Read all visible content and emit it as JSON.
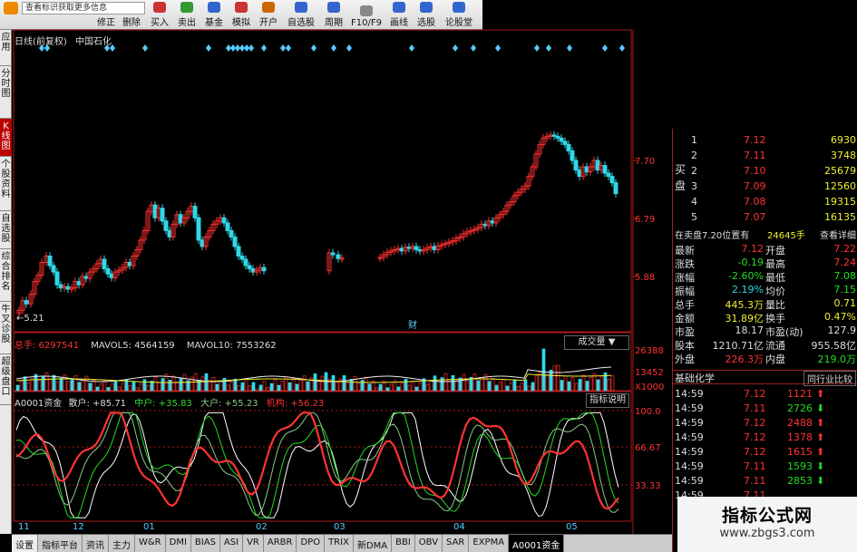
{
  "toolbar": {
    "info_placeholder": "查看标识获取更多信息",
    "edit_label": "修正",
    "delete_label": "删除",
    "buttons": [
      {
        "label": "买入",
        "color": "#c33"
      },
      {
        "label": "卖出",
        "color": "#393"
      },
      {
        "label": "基金",
        "color": "#36c"
      },
      {
        "label": "模拟",
        "color": "#c33"
      },
      {
        "label": "开户",
        "color": "#c60"
      },
      {
        "label": "自选股",
        "color": "#36c"
      },
      {
        "label": "周期",
        "color": "#36c"
      },
      {
        "label": "F10/F9",
        "color": "#888"
      },
      {
        "label": "画线",
        "color": "#36c"
      },
      {
        "label": "选股",
        "color": "#36c"
      },
      {
        "label": "论股堂",
        "color": "#36c"
      }
    ]
  },
  "left_tabs": [
    {
      "label": "应用",
      "active": false
    },
    {
      "label": "分时图",
      "active": false
    },
    {
      "label": "K线图",
      "active": true
    },
    {
      "label": "个股资料",
      "active": false
    },
    {
      "label": "自选股",
      "active": false
    },
    {
      "label": "综合排名",
      "active": false
    },
    {
      "label": "牛叉诊股",
      "active": false
    },
    {
      "label": "超级盘口",
      "active": false
    }
  ],
  "main_chart": {
    "title": "日线(前复权)",
    "stock_name": "中国石化",
    "price_ticks": [
      "7.70",
      "6.79",
      "5.88"
    ],
    "low_label": "←5.21",
    "event_marker": "财"
  },
  "volume_panel": {
    "total_label": "总手: 6297541",
    "mavol5_label": "MAVOL5: 4564159",
    "mavol10_label": "MAVOL10: 7553262",
    "selector_label": "成交量",
    "ticks": [
      "26388",
      "13452",
      "X1000"
    ]
  },
  "fund_panel": {
    "name": "A0001资金",
    "retail_label": "散户: +85.71",
    "mid_label": "中户: +35.83",
    "large_label": "大户: +55.23",
    "inst_label": "机构: +56.23",
    "help_button": "指标说明",
    "ticks": [
      "100.0",
      "66.67",
      "33.33"
    ]
  },
  "x_axis": {
    "months": [
      "11",
      "12",
      "01",
      "02",
      "03",
      "04",
      "05"
    ]
  },
  "order_book": {
    "side_label": "买盘",
    "bids": [
      {
        "level": "1",
        "price": "7.12",
        "volume": "6930"
      },
      {
        "level": "2",
        "price": "7.11",
        "volume": "3748"
      },
      {
        "level": "2",
        "price": "7.10",
        "volume": "25679"
      },
      {
        "level": "3",
        "price": "7.09",
        "volume": "12560"
      },
      {
        "level": "4",
        "price": "7.08",
        "volume": "19315"
      },
      {
        "level": "5",
        "price": "7.07",
        "volume": "16135"
      }
    ],
    "sell_info": "在卖盘7.20位置有",
    "sell_qty": "24645手",
    "detail_button": "查看详细"
  },
  "quote_stats": [
    {
      "l1": "最新",
      "v1": "7.12",
      "c1": "r",
      "l2": "开盘",
      "v2": "7.22",
      "c2": "r"
    },
    {
      "l1": "涨跌",
      "v1": "-0.19",
      "c1": "g",
      "l2": "最高",
      "v2": "7.24",
      "c2": "r"
    },
    {
      "l1": "涨幅",
      "v1": "-2.60%",
      "c1": "g",
      "l2": "最低",
      "v2": "7.08",
      "c2": "g"
    },
    {
      "l1": "振幅",
      "v1": "2.19%",
      "c1": "c",
      "l2": "均价",
      "v2": "7.15",
      "c2": "g"
    },
    {
      "l1": "总手",
      "v1": "445.3万",
      "c1": "y",
      "l2": "量比",
      "v2": "0.71",
      "c2": "y"
    },
    {
      "l1": "金额",
      "v1": "31.89亿",
      "c1": "y",
      "l2": "换手",
      "v2": "0.47%",
      "c2": "y"
    },
    {
      "l1": "市盈",
      "v1": "18.17",
      "c1": "t",
      "l2": "市盈(动)",
      "v2": "127.9",
      "c2": "t"
    },
    {
      "l1": "股本",
      "v1": "1210.71亿",
      "c1": "t",
      "l2": "流通",
      "v2": "955.58亿",
      "c2": "t"
    },
    {
      "l1": "外盘",
      "v1": "226.3万",
      "c1": "r",
      "l2": "内盘",
      "v2": "219.0万",
      "c2": "g"
    }
  ],
  "industry": {
    "name": "基础化学",
    "compare_button": "同行业比较"
  },
  "ticks": [
    {
      "time": "14:59",
      "price": "7.12",
      "vol": "1121",
      "dir": "up"
    },
    {
      "time": "14:59",
      "price": "7.11",
      "vol": "2726",
      "dir": "down"
    },
    {
      "time": "14:59",
      "price": "7.12",
      "vol": "2488",
      "dir": "up"
    },
    {
      "time": "14:59",
      "price": "7.12",
      "vol": "1378",
      "dir": "up"
    },
    {
      "time": "14:59",
      "price": "7.12",
      "vol": "1615",
      "dir": "up"
    },
    {
      "time": "14:59",
      "price": "7.11",
      "vol": "1593",
      "dir": "down"
    },
    {
      "time": "14:59",
      "price": "7.11",
      "vol": "2853",
      "dir": "down"
    },
    {
      "time": "14:59",
      "price": "7.11",
      "vol": "",
      "dir": ""
    }
  ],
  "bottom_tabs": [
    "设置",
    "指标平台",
    "资讯",
    "主力",
    "W&R",
    "DMI",
    "BIAS",
    "ASI",
    "VR",
    "ARBR",
    "DPO",
    "TRIX",
    "新DMA",
    "BBI",
    "OBV",
    "SAR",
    "EXPMA",
    "A0001资金"
  ],
  "active_bottom_tab": "A0001资金",
  "watermark": {
    "line1": "指标公式网",
    "line2": "www.zbgs3.com"
  },
  "colors": {
    "up": "#ff3030",
    "down": "#30d8e8",
    "grid": "#aa1a1a"
  }
}
